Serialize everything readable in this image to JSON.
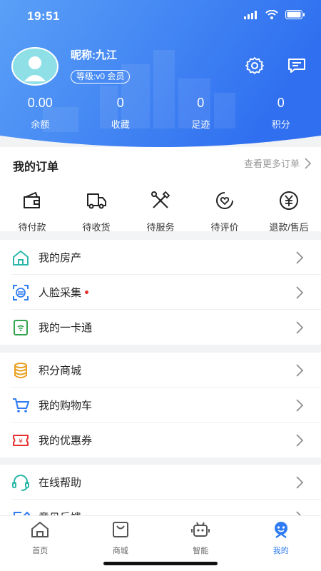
{
  "status_bar": {
    "time": "19:51"
  },
  "profile": {
    "nickname": "昵称:九江",
    "level": "等级:v0 会员"
  },
  "stats": [
    {
      "value": "0.00",
      "label": "余额"
    },
    {
      "value": "0",
      "label": "收藏"
    },
    {
      "value": "0",
      "label": "足迹"
    },
    {
      "value": "0",
      "label": "积分"
    }
  ],
  "orders": {
    "title": "我的订单",
    "more": "查看更多订单",
    "items": [
      {
        "label": "待付款",
        "icon": "wallet-icon"
      },
      {
        "label": "待收货",
        "icon": "truck-icon"
      },
      {
        "label": "待服务",
        "icon": "tools-icon"
      },
      {
        "label": "待评价",
        "icon": "review-icon"
      },
      {
        "label": "退款/售后",
        "icon": "refund-icon"
      }
    ]
  },
  "menu": {
    "group1": [
      {
        "label": "我的房产",
        "icon": "house-icon"
      },
      {
        "label": "人脸采集",
        "icon": "face-scan-icon"
      },
      {
        "label": "我的一卡通",
        "icon": "card-icon"
      }
    ],
    "group2": [
      {
        "label": "积分商城",
        "icon": "coins-icon"
      },
      {
        "label": "我的购物车",
        "icon": "cart-icon"
      },
      {
        "label": "我的优惠券",
        "icon": "coupon-icon"
      }
    ],
    "group3": [
      {
        "label": "在线帮助",
        "icon": "headset-icon"
      },
      {
        "label": "意见反馈",
        "icon": "feedback-icon"
      }
    ]
  },
  "tabs": [
    {
      "label": "首页",
      "icon": "home-icon"
    },
    {
      "label": "商城",
      "icon": "shop-icon"
    },
    {
      "label": "智能",
      "icon": "robot-icon"
    },
    {
      "label": "我的",
      "icon": "mine-icon"
    }
  ],
  "colors": {
    "brand_blue": "#2f7bf2",
    "active_tab": "#2f7bf2",
    "dot_red": "#e6302f",
    "teal": "#2bb8a8"
  }
}
